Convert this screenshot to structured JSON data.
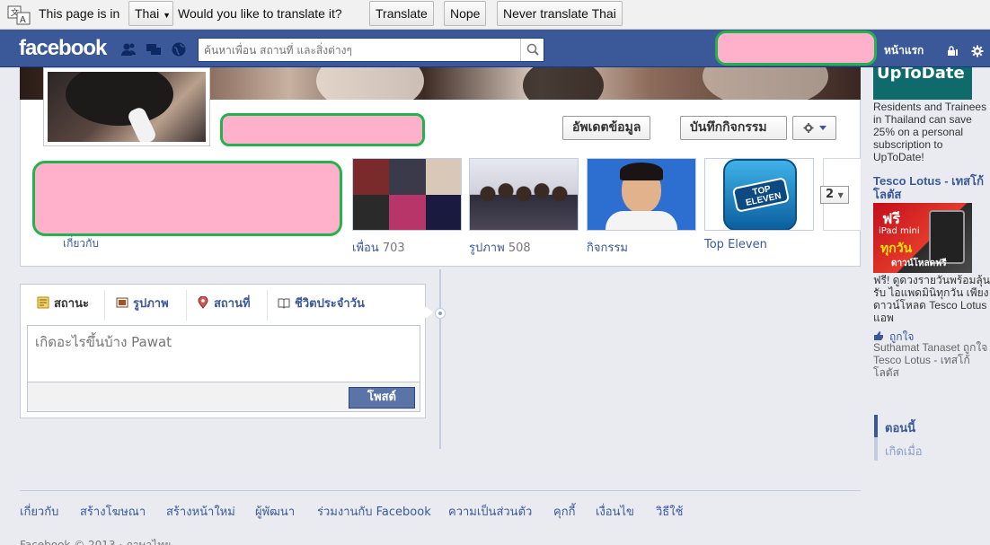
{
  "translate_bar": {
    "prefix": "This page is in",
    "language": "Thai",
    "question": "Would you like to translate it?",
    "translate_label": "Translate",
    "nope_label": "Nope",
    "never_label": "Never translate Thai"
  },
  "header": {
    "logo": "facebook",
    "search_placeholder": "ค้นหาเพื่อน สถานที่ และสิ่งต่างๆ",
    "home_label": "หน้าแรก"
  },
  "profile": {
    "update_info_label": "อัพเดตข้อมูล",
    "activity_log_label": "บันทึกกิจกรรม",
    "more_count": "2",
    "about_label": "เกี่ยวกับ",
    "tiles": [
      {
        "label": "เพื่อน",
        "count": "703"
      },
      {
        "label": "รูปภาพ",
        "count": "508"
      },
      {
        "label": "กิจกรรม",
        "count": ""
      },
      {
        "label": "Top Eleven",
        "count": ""
      }
    ],
    "top_eleven_logo": "TOP ELEVEN"
  },
  "composer": {
    "tabs": [
      {
        "label": "สถานะ",
        "icon": "status-icon"
      },
      {
        "label": "รูปภาพ",
        "icon": "photo-icon"
      },
      {
        "label": "สถานที่",
        "icon": "place-icon"
      },
      {
        "label": "ชีวิตประจำวัน",
        "icon": "life-event-icon"
      }
    ],
    "placeholder": "เกิดอะไรขึ้นบ้าง Pawat",
    "post_label": "โพสต์"
  },
  "sidebar": {
    "ad1_image_text": "UpToDate",
    "ad1_body": "Residents and Trainees in Thailand can save 25% on a personal subscription to UpToDate!",
    "ad2_title": "Tesco Lotus - เทสโก้ โลตัส",
    "ad2_image": {
      "free": "ฟรี",
      "product": "iPad mini",
      "every_day": "ทุกวัน",
      "download": "ดาวน์โหลดฟรี"
    },
    "ad2_body": "ฟรี! ดูดวงรายวันพร้อมลุ้นรับ ไอแพดมินิทุกวัน เพียงดาวน์โหลด Tesco Lotus แอพ",
    "like_label": "ถูกใจ",
    "like_text": "Suthamat Tanaset ถูกใจ Tesco Lotus - เทสโก้ โลตัส",
    "timeline_now": "ตอนนี้",
    "timeline_born": "เกิดเมื่อ"
  },
  "footer": {
    "links": [
      "เกี่ยวกับ",
      "สร้างโฆษณา",
      "สร้างหน้าใหม่",
      "ผู้พัฒนา",
      "ร่วมงานกับ Facebook",
      "ความเป็นส่วนตัว",
      "คุกกี้",
      "เงื่อนไข",
      "วิธีใช้"
    ],
    "copyright": "Facebook © 2013 · ภาษาไทย"
  },
  "colors": {
    "facebook_blue": "#3b5998",
    "redaction_fill": "#ffb1cc",
    "redaction_border": "#23b24b"
  }
}
